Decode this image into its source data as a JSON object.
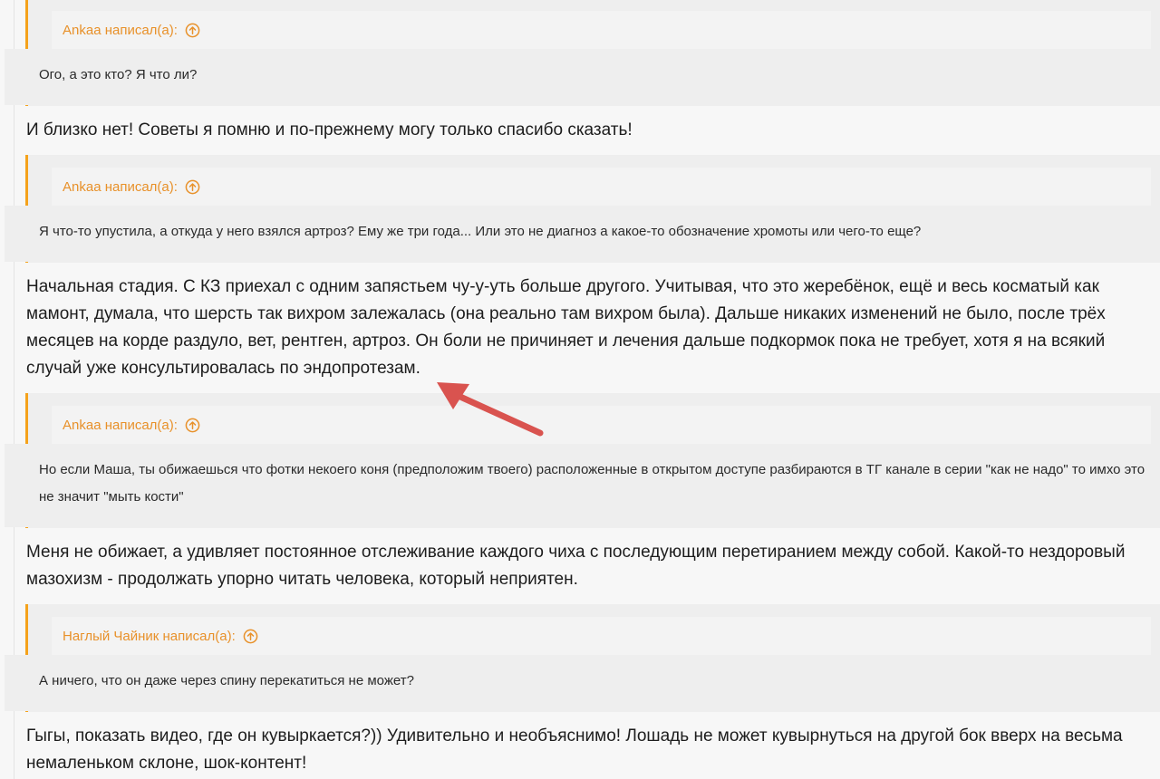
{
  "colors": {
    "accent": "#f5a21b",
    "quote_author": "#e8912a",
    "annotation_arrow": "#d9534f"
  },
  "posts": [
    {
      "quote": {
        "author": "Ankaa написал(а):",
        "icon": "arrow-up-circle-icon",
        "text": "Ого, а это кто? Я что ли?"
      },
      "reply": "И близко нет! Советы я помню и по-прежнему могу только спасибо сказать!"
    },
    {
      "quote": {
        "author": "Ankaa написал(а):",
        "icon": "arrow-up-circle-icon",
        "text": "Я что-то упустила, а откуда у него взялся артроз? Ему же три года... Или это не диагноз а какое-то обозначение хромоты или чего-то еще?"
      },
      "reply": "Начальная стадия. С КЗ приехал с одним запястьем чу-у-уть больше другого. Учитывая, что это жеребёнок, ещё и весь косматый как мамонт, думала, что шерсть так вихром залежалась (она реально там вихром была). Дальше никаких изменений не было, после трёх месяцев на корде раздуло, вет, рентген, артроз. Он боли не причиняет и лечения дальше подкормок пока не требует, хотя я на всякий случай уже консультировалась по эндопротезам."
    },
    {
      "quote": {
        "author": "Ankaa написал(а):",
        "icon": "arrow-up-circle-icon",
        "text": "Но если Маша, ты обижаешься что фотки некоего коня (предположим твоего) расположенные в открытом доступе разбираются в ТГ канале в серии \"как не надо\" то имхо это не значит \"мыть кости\""
      },
      "reply": "Меня не обижает, а удивляет постоянное отслеживание каждого чиха с последующим перетиранием между собой. Какой-то нездоровый мазохизм - продолжать упорно читать человека, который неприятен."
    },
    {
      "quote": {
        "author": "Наглый Чайник написал(а):",
        "icon": "arrow-up-circle-icon",
        "text": "А ничего, что он даже через спину перекатиться не может?"
      },
      "reply": "Гыгы, показать видео, где он кувыркается?)) Удивительно и необъяснимо! Лошадь не может кувырнуться на другой бок вверх на весьма немаленьком склоне, шок-контент!"
    }
  ]
}
